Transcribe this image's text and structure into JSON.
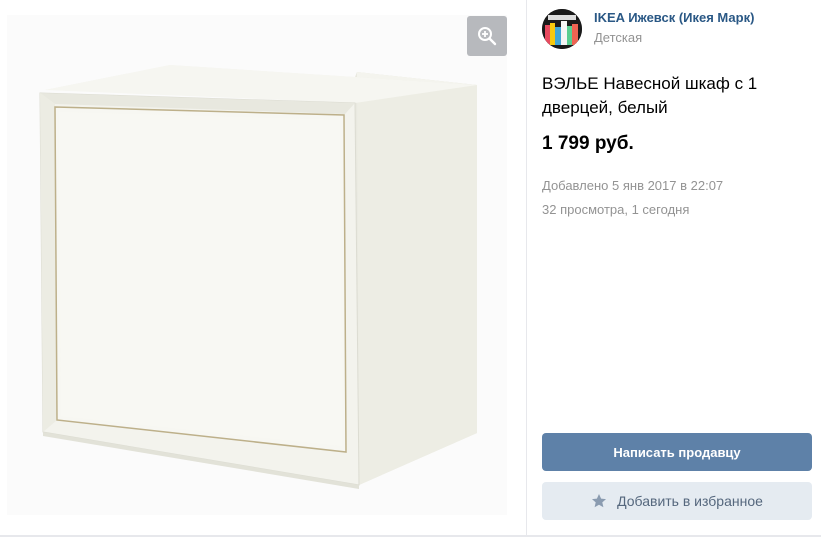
{
  "seller": {
    "name": "IKEA Ижевск (Икея Марк)",
    "category": "Детская",
    "avatar_icon": "store-avatar"
  },
  "item": {
    "title": "ВЭЛЬЕ Навесной шкаф с 1 дверцей, белый",
    "price": "1 799 руб.",
    "added": "Добавлено 5 янв 2017 в 22:07",
    "views": "32 просмотра, 1 сегодня",
    "image_icon": "white-cabinet-product-photo"
  },
  "actions": {
    "contact_seller": "Написать продавцу",
    "add_favorite": "Добавить в избранное",
    "zoom_icon": "zoom-in-icon",
    "favorite_icon": "star-icon"
  },
  "colors": {
    "link": "#2a5885",
    "primary_button": "#5e81a8",
    "secondary_button": "#e5ebf1",
    "muted_text": "#939393"
  }
}
